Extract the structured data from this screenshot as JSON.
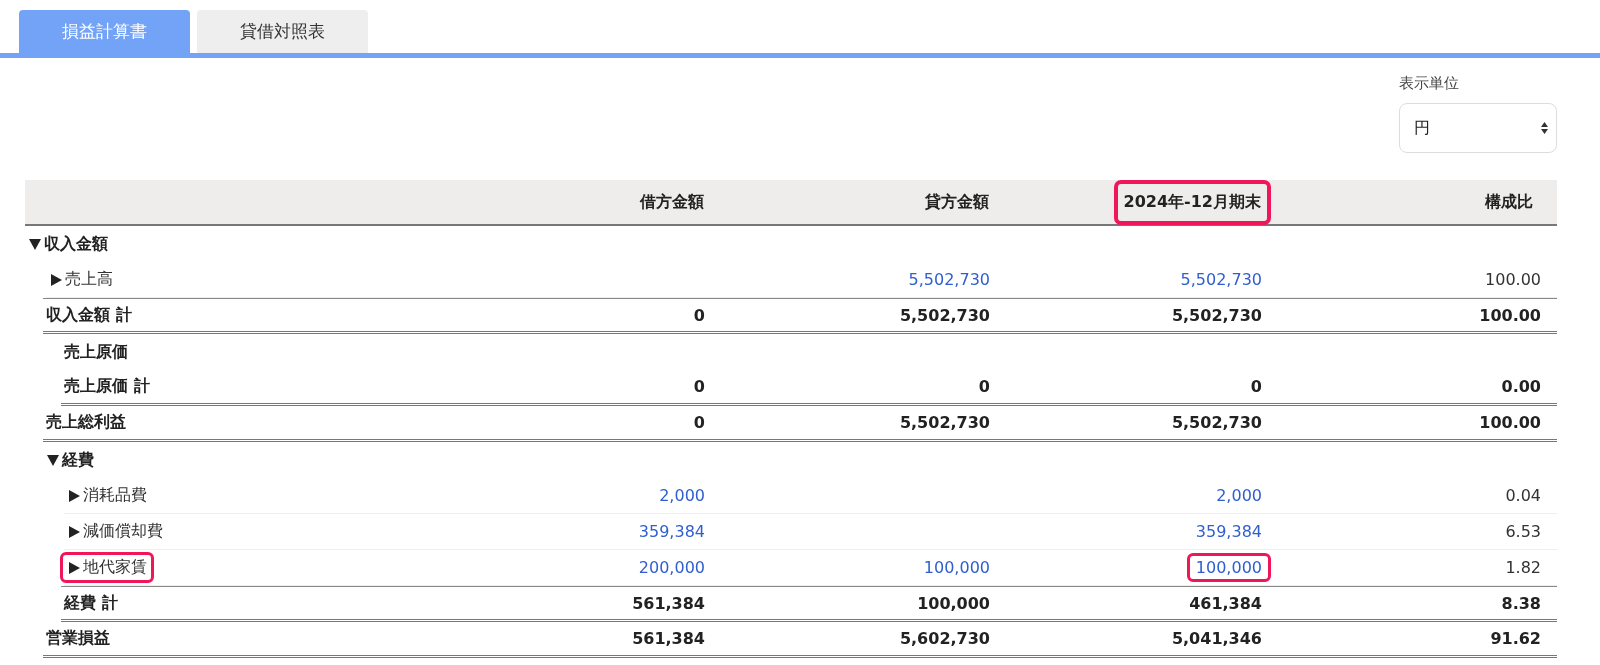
{
  "tabs": [
    {
      "label": "損益計算書",
      "selected": true
    },
    {
      "label": "貸借対照表",
      "selected": false
    }
  ],
  "unit_select": {
    "label": "表示単位",
    "value": "円"
  },
  "table": {
    "columns": [
      {
        "label": "借方金額",
        "highlighted": false
      },
      {
        "label": "貸方金額",
        "highlighted": false
      },
      {
        "label": "2024年-12月期末",
        "highlighted": true
      },
      {
        "label": "構成比",
        "highlighted": false
      }
    ],
    "rows": [
      {
        "kind": "section",
        "label": "収入金額",
        "expanded": true,
        "children": [
          {
            "kind": "item",
            "label": "売上高",
            "expanded": false,
            "cells": [
              null,
              {
                "text": "5,502,730"
              },
              {
                "text": "5,502,730"
              },
              {
                "text": "100.00"
              }
            ]
          },
          {
            "kind": "total",
            "label": "収入金額 計",
            "cells": [
              {
                "text": "0"
              },
              {
                "text": "5,502,730"
              },
              {
                "text": "5,502,730"
              },
              {
                "text": "100.00"
              }
            ]
          },
          {
            "kind": "group",
            "children": [
              {
                "kind": "heading",
                "label": "売上原価"
              },
              {
                "kind": "total",
                "label": "売上原価 計",
                "cells": [
                  {
                    "text": "0"
                  },
                  {
                    "text": "0"
                  },
                  {
                    "text": "0"
                  },
                  {
                    "text": "0.00"
                  }
                ]
              }
            ]
          },
          {
            "kind": "total",
            "label": "売上総利益",
            "cells": [
              {
                "text": "0"
              },
              {
                "text": "5,502,730"
              },
              {
                "text": "5,502,730"
              },
              {
                "text": "100.00"
              }
            ]
          },
          {
            "kind": "section",
            "label": "経費",
            "expanded": true,
            "children": [
              {
                "kind": "item",
                "label": "消耗品費",
                "expanded": false,
                "cells": [
                  {
                    "text": "2,000"
                  },
                  null,
                  {
                    "text": "2,000"
                  },
                  {
                    "text": "0.04"
                  }
                ]
              },
              {
                "kind": "item",
                "label": "減価償却費",
                "expanded": false,
                "cells": [
                  {
                    "text": "359,384"
                  },
                  null,
                  {
                    "text": "359,384"
                  },
                  {
                    "text": "6.53"
                  }
                ]
              },
              {
                "kind": "item",
                "label": "地代家賃",
                "expanded": false,
                "label_highlighted": true,
                "cells": [
                  {
                    "text": "200,000"
                  },
                  {
                    "text": "100,000"
                  },
                  {
                    "text": "100,000",
                    "highlighted": true
                  },
                  {
                    "text": "1.82"
                  }
                ]
              },
              {
                "kind": "total",
                "label": "経費 計",
                "cells": [
                  {
                    "text": "561,384"
                  },
                  {
                    "text": "100,000"
                  },
                  {
                    "text": "461,384"
                  },
                  {
                    "text": "8.38"
                  }
                ]
              }
            ]
          },
          {
            "kind": "total",
            "label": "営業損益",
            "cells": [
              {
                "text": "561,384"
              },
              {
                "text": "5,602,730"
              },
              {
                "text": "5,041,346"
              },
              {
                "text": "91.62"
              }
            ]
          }
        ]
      }
    ]
  }
}
